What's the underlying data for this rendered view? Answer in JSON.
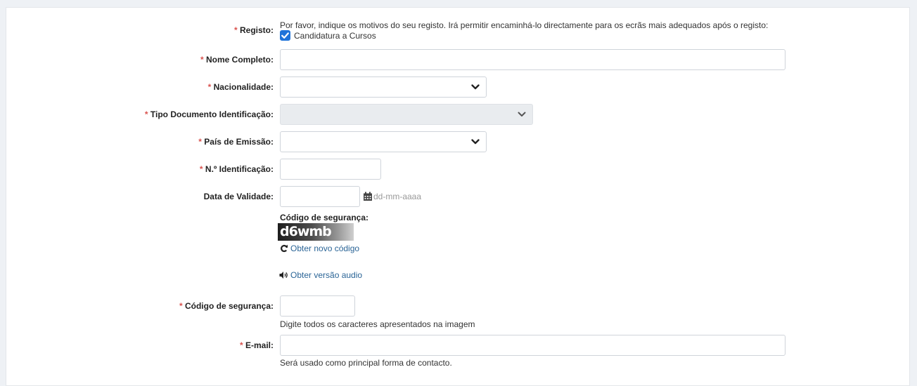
{
  "form": {
    "registo": {
      "label": "Registo:",
      "required_mark": "*",
      "intro": "Por favor, indique os motivos do seu registo. Irá permitir encaminhá-lo directamente para os ecrãs mais adequados após o registo:",
      "option_label": "Candidatura a Cursos",
      "option_checked": true
    },
    "nome": {
      "label": "Nome Completo:",
      "required_mark": "*",
      "value": ""
    },
    "nacionalidade": {
      "label": "Nacionalidade:",
      "required_mark": "*",
      "selected": ""
    },
    "tipo_doc": {
      "label": "Tipo Documento Identificação:",
      "required_mark": "*",
      "selected": "",
      "disabled": true
    },
    "pais_emissao": {
      "label": "País de Emissão:",
      "required_mark": "*",
      "selected": ""
    },
    "n_identificacao": {
      "label": "N.º Identificação:",
      "required_mark": "*",
      "value": ""
    },
    "data_validade": {
      "label": "Data de Validade:",
      "value": "",
      "format_hint": "dd-mm-aaaa"
    },
    "captcha": {
      "title": "Código de segurança:",
      "image_text": "d6wmb",
      "new_code_link": "Obter novo código",
      "audio_link": "Obter versão audio"
    },
    "codigo": {
      "label": "Código de segurança:",
      "required_mark": "*",
      "value": "",
      "help": "Digite todos os caracteres apresentados na imagem"
    },
    "email": {
      "label": "E-mail:",
      "required_mark": "*",
      "value": "",
      "help": "Será usado como principal forma de contacto."
    }
  },
  "colors": {
    "required": "#d9534f",
    "link": "#2a6496",
    "checkbox": "#1f73d9",
    "page_bg": "#eef1f5"
  },
  "icons": {
    "calendar": "calendar-icon",
    "refresh": "refresh-icon",
    "audio": "volume-icon",
    "select": "chevron-down-icon"
  }
}
